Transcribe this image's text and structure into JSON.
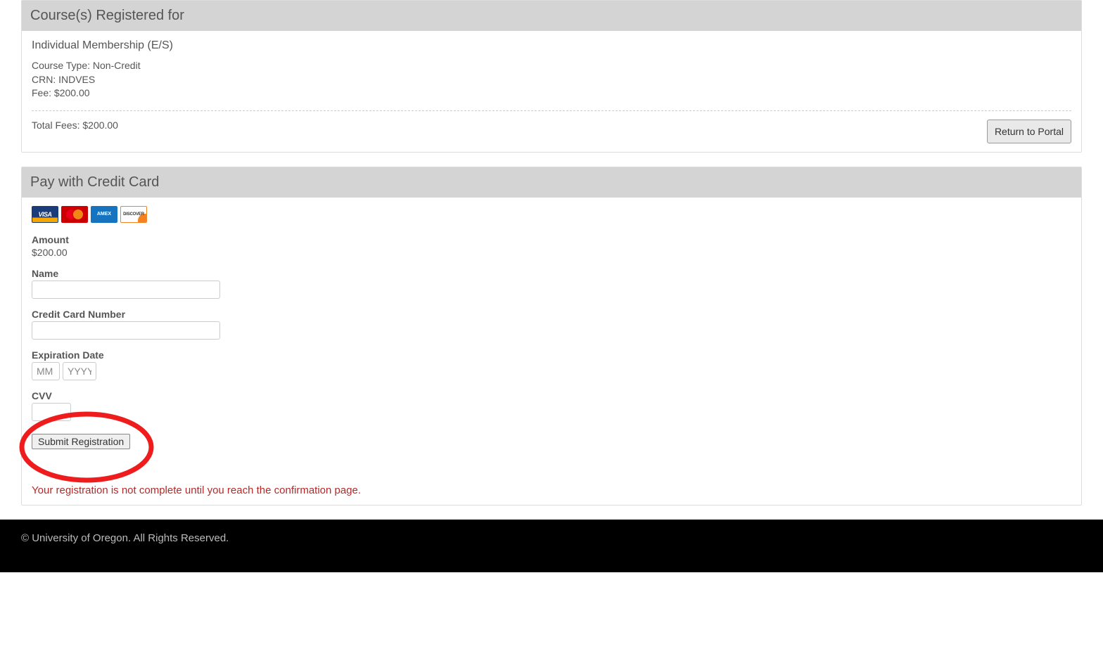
{
  "courses_panel": {
    "title": "Course(s) Registered for",
    "course_name": "Individual Membership (E/S)",
    "course_type_line": "Course Type: Non-Credit",
    "crn_line": "CRN: INDVES",
    "fee_line": "Fee: $200.00",
    "total_fees": "Total Fees: $200.00",
    "return_button": "Return to Portal"
  },
  "payment_panel": {
    "title": "Pay with Credit Card",
    "amount_label": "Amount",
    "amount_value": "$200.00",
    "name_label": "Name",
    "name_value": "",
    "card_label": "Credit Card Number",
    "card_value": "",
    "exp_label": "Expiration Date",
    "exp_mm_placeholder": "MM",
    "exp_yyyy_placeholder": "YYYY",
    "cvv_label": "CVV",
    "cvv_value": "",
    "submit_label": "Submit Registration",
    "warning": "Your registration is not complete until you reach the confirmation page."
  },
  "footer": {
    "copyright": "© University of Oregon. All Rights Reserved."
  },
  "card_icons": {
    "visa": "VISA",
    "amex": "AMEX",
    "discover": "DISCOVER"
  }
}
